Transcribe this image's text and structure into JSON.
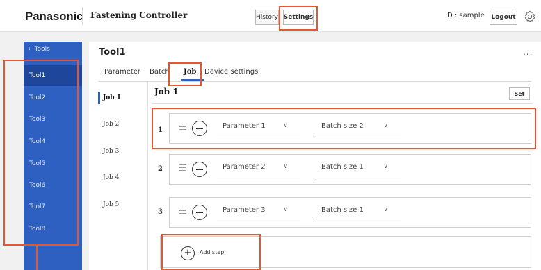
{
  "header": {
    "brand": "Panasonic",
    "app_title": "Fastening Controller",
    "history_label": "History",
    "settings_label": "Settings",
    "user_id": "ID : sample",
    "logout_label": "Logout"
  },
  "sidebar": {
    "back_label": "Tools",
    "items": [
      {
        "label": "Tool1"
      },
      {
        "label": "Tool2"
      },
      {
        "label": "Tool3"
      },
      {
        "label": "Tool4"
      },
      {
        "label": "Tool5"
      },
      {
        "label": "Tool6"
      },
      {
        "label": "Tool7"
      },
      {
        "label": "Tool8"
      }
    ],
    "active_index": 0
  },
  "main": {
    "title": "Tool1",
    "more": "...",
    "tabs": [
      {
        "label": "Parameter"
      },
      {
        "label": "Batch"
      },
      {
        "label": "Job"
      },
      {
        "label": "Device settings"
      }
    ],
    "active_tab": "Job",
    "jobs": [
      "Job 1",
      "Job 2",
      "Job 3",
      "Job 4",
      "Job 5"
    ],
    "selected_job": "Job 1",
    "job_heading": "Job 1",
    "set_label": "Set",
    "steps": [
      {
        "number": "1",
        "parameter": "Parameter 1",
        "batch": "Batch size 2"
      },
      {
        "number": "2",
        "parameter": "Parameter 2",
        "batch": "Batch size 1"
      },
      {
        "number": "3",
        "parameter": "Parameter 3",
        "batch": "Batch size 1"
      }
    ],
    "add_step_label": "Add step"
  },
  "colors": {
    "accent": "#2d60c1",
    "sidebar_active": "#1e469a",
    "highlight": "#e8552f"
  }
}
